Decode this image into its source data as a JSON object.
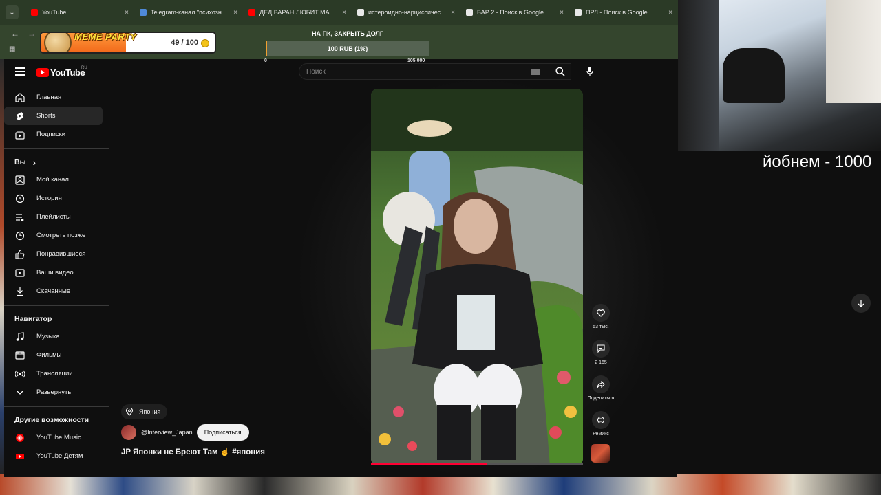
{
  "browser": {
    "tabs": [
      {
        "title": "YouTube",
        "favicon_color": "#ff0000",
        "active": false
      },
      {
        "title": "Telegram-канал \"психознакомства\"",
        "favicon_color": "#4f8ad9",
        "active": false
      },
      {
        "title": "ДЕД ВАРАН ЛЮБИТ МАЛЬЧИКОВ",
        "favicon_color": "#ff0000",
        "active": false
      },
      {
        "title": "истероидно-нарциссический",
        "favicon_color": "#e8e8e8",
        "active": false
      },
      {
        "title": "БАР 2 - Поиск в Google",
        "favicon_color": "#e8e8e8",
        "active": false
      },
      {
        "title": "ПРЛ - Поиск в Google",
        "favicon_color": "#e8e8e8",
        "active": false
      }
    ],
    "tab_close": "×"
  },
  "stream_widgets": {
    "meme_party": {
      "title": "MEME PARTY",
      "count": "49 / 100",
      "progress": 0.49
    },
    "donation_goal": {
      "title": "НА ПК, ЗАКРЫТЬ ДОЛГ",
      "label": "100 RUB (1%)",
      "progress": 0.01,
      "min": "0",
      "max": "105 000"
    },
    "overlay_text": "йобнем - 1000"
  },
  "youtube": {
    "logo": "YouTube",
    "region": "RU",
    "search_placeholder": "Поиск",
    "sidebar": {
      "main": [
        {
          "label": "Главная",
          "icon": "home-icon"
        },
        {
          "label": "Shorts",
          "icon": "shorts-icon",
          "active": true
        },
        {
          "label": "Подписки",
          "icon": "subscriptions-icon"
        }
      ],
      "you_heading": "Вы",
      "you": [
        {
          "label": "Мой канал",
          "icon": "channel-icon"
        },
        {
          "label": "История",
          "icon": "history-icon"
        },
        {
          "label": "Плейлисты",
          "icon": "playlists-icon"
        },
        {
          "label": "Смотреть позже",
          "icon": "watch-later-icon"
        },
        {
          "label": "Понравившиеся",
          "icon": "like-icon"
        },
        {
          "label": "Ваши видео",
          "icon": "your-videos-icon"
        },
        {
          "label": "Скачанные",
          "icon": "download-icon"
        }
      ],
      "nav_heading": "Навигатор",
      "nav": [
        {
          "label": "Музыка",
          "icon": "music-icon"
        },
        {
          "label": "Фильмы",
          "icon": "movies-icon"
        },
        {
          "label": "Трансляции",
          "icon": "live-icon"
        },
        {
          "label": "Развернуть",
          "icon": "chevron-down-icon"
        }
      ],
      "more_heading": "Другие возможности",
      "more": [
        {
          "label": "YouTube Music",
          "icon": "youtube-music-icon"
        },
        {
          "label": "YouTube Детям",
          "icon": "youtube-kids-icon"
        }
      ]
    },
    "short": {
      "location": "Япония",
      "channel": "@Interview_Japan",
      "subscribe": "Подписаться",
      "title": "JP Японки не Бреют Там ☝️ #япония",
      "progress": 0.55,
      "actions": {
        "likes": "53 тыс.",
        "comments": "2 165",
        "share": "Поделиться",
        "remix": "Ремикс"
      }
    }
  }
}
